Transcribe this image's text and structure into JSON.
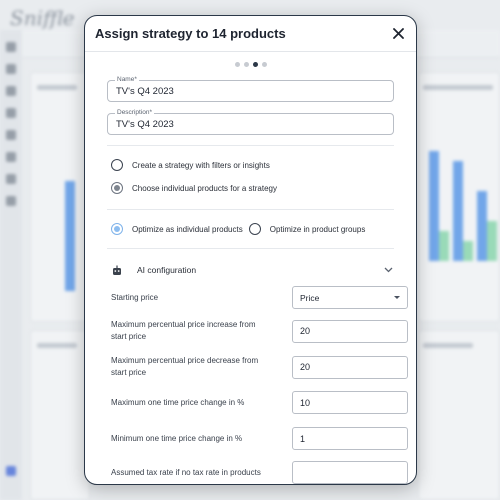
{
  "modal": {
    "title": "Assign strategy to 14 products",
    "steps": {
      "count": 4,
      "active_index": 2
    },
    "name_field": {
      "label": "Name*",
      "value": "TV's Q4 2023"
    },
    "description_field": {
      "label": "Description*",
      "value": "TV's Q4 2023"
    },
    "selection_mode": {
      "options": [
        {
          "label": "Create a strategy with filters or insights",
          "selected": false
        },
        {
          "label": "Choose individual products for a strategy",
          "selected": true
        }
      ]
    },
    "optimization_mode": {
      "options": [
        {
          "label": "Optimize as individual products",
          "selected": true
        },
        {
          "label": "Optimize in product groups",
          "selected": false
        }
      ]
    },
    "ai_configuration": {
      "label": "AI configuration",
      "icon": "robot-icon",
      "expanded": true,
      "fields": {
        "starting_price": {
          "label": "Starting price",
          "value": "Price"
        },
        "max_pct_increase": {
          "label": "Maximum percentual price increase from start price",
          "value": "20"
        },
        "max_pct_decrease": {
          "label": "Maximum percentual price decrease from start price",
          "value": "20"
        },
        "max_one_time_change": {
          "label": "Maximum one time price change in %",
          "value": "10"
        },
        "min_one_time_change": {
          "label": "Minimum one time price change in %",
          "value": "1"
        },
        "assumed_tax_rate": {
          "label": "Assumed tax rate if no tax rate in products",
          "value": ""
        }
      }
    }
  },
  "colors": {
    "modal_border": "#2b3848",
    "radio_selected_blue": "#8dbdf0",
    "chart_blue": "#4a8fe7",
    "chart_green": "#7fd4a6"
  }
}
